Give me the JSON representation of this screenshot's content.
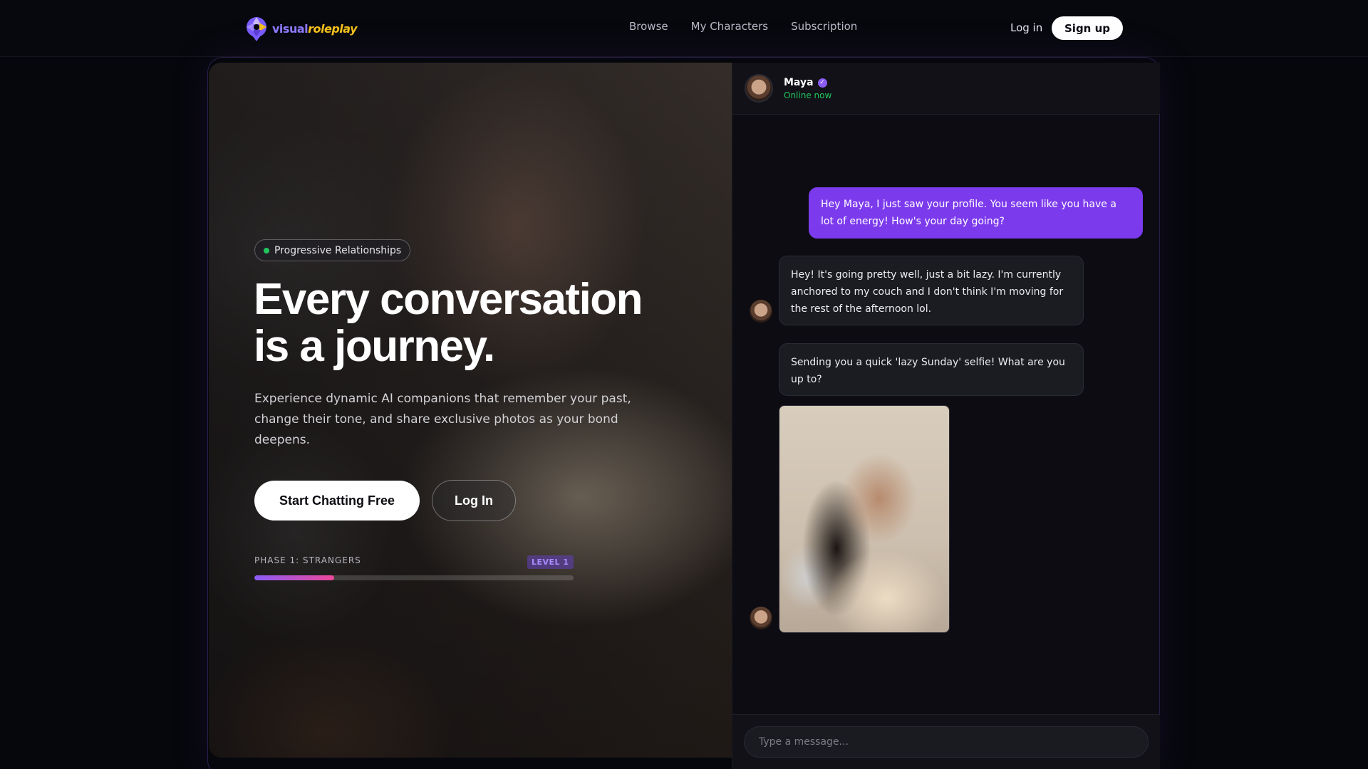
{
  "brand": {
    "name_part1": "visual",
    "name_part2": "roleplay",
    "logo_icon": "aperture-logo-icon",
    "colors": {
      "primary": "#8f7bff",
      "accent": "#f4c21b"
    }
  },
  "nav": {
    "links": [
      "Browse",
      "My Characters",
      "Subscription"
    ],
    "login_label": "Log in",
    "signup_label": "Sign up"
  },
  "hero": {
    "badge": "Progressive Relationships",
    "title_line1": "Every conversation",
    "title_line2": "is a journey.",
    "subtitle": "Experience dynamic AI companions that remember your past, change their tone, and share exclusive photos as your bond deepens.",
    "primary_cta": "Start Chatting Free",
    "secondary_cta": "Log In",
    "phase_label": "PHASE 1: STRANGERS",
    "level_label": "LEVEL 1",
    "progress_fraction": 0.25,
    "progress_colors": [
      "#8b5cf6",
      "#ec4899"
    ]
  },
  "chat": {
    "name": "Maya",
    "status": "Online now",
    "verified_icon": "verified-check-icon",
    "messages": {
      "user_1": "Hey Maya, I just saw your profile. You seem like you have a lot of energy! How's your day going?",
      "bot_1": "Hey! It's going pretty well, just a bit lazy. I'm currently anchored to my couch and I don't think I'm moving for the rest of the afternoon lol.",
      "bot_2": "Sending you a quick 'lazy Sunday' selfie! What are you up to?"
    },
    "composer_placeholder": "Type a message...",
    "colors": {
      "user_bubble": "#7c3aed",
      "bot_bubble": "#1b1b22",
      "online": "#22c55e"
    }
  }
}
